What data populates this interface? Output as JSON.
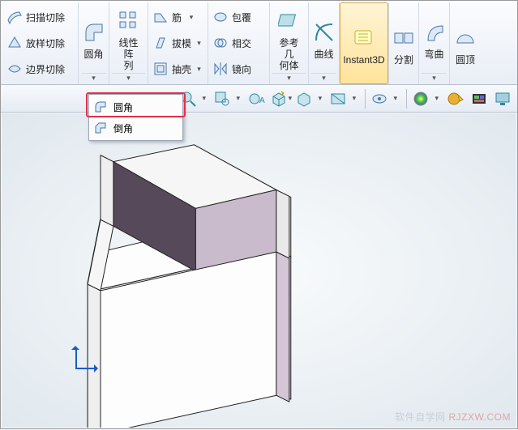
{
  "ribbon": {
    "col_cut": {
      "sweep_cut": "扫描切除",
      "loft_cut": "放样切除",
      "boundary_cut": "边界切除"
    },
    "fillet": "圆角",
    "linear_pattern": "线性阵\n列",
    "col_mid": {
      "rib": "筋",
      "draft": "拔模",
      "shell": "抽壳"
    },
    "col_mid2": {
      "wrap": "包覆",
      "intersect": "相交",
      "mirror": "镜向"
    },
    "ref_geom": "参考几\n何体",
    "curves": "曲线",
    "instant3d": "Instant3D",
    "split": "分割",
    "bend": "弯曲",
    "dome": "圆顶"
  },
  "dropdown": {
    "fillet": "圆角",
    "chamfer": "倒角"
  },
  "watermark": {
    "label": "软件自学网",
    "site": "RJZXW.COM"
  }
}
